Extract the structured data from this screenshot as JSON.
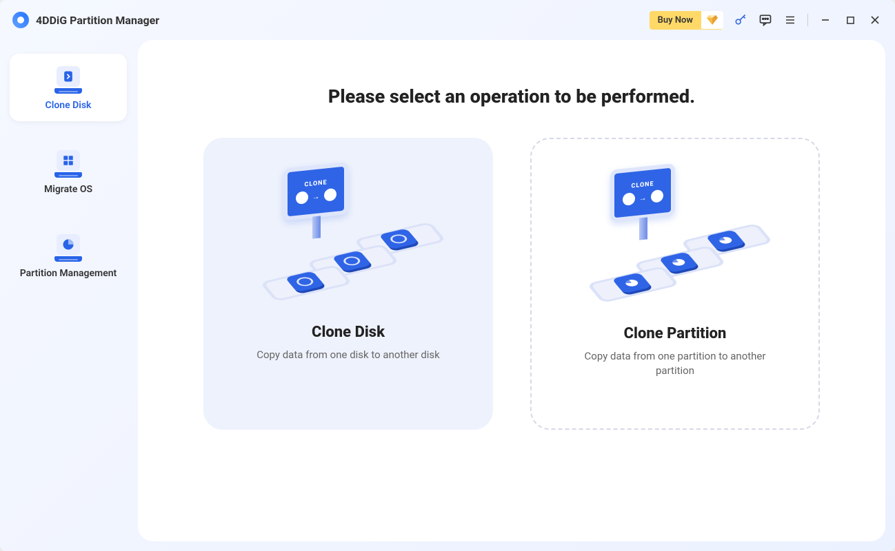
{
  "app": {
    "title": "4DDiG Partition Manager"
  },
  "titlebar": {
    "buy_now": "Buy Now"
  },
  "sidebar": {
    "items": [
      {
        "label": "Clone Disk",
        "active": true
      },
      {
        "label": "Migrate OS",
        "active": false
      },
      {
        "label": "Partition Management",
        "active": false
      }
    ]
  },
  "main": {
    "heading": "Please select an operation to be performed.",
    "cards": [
      {
        "title": "Clone Disk",
        "description": "Copy data from one disk to another disk",
        "monitor_label": "CLONE",
        "state": "selected"
      },
      {
        "title": "Clone Partition",
        "description": "Copy data from one partition to another partition",
        "monitor_label": "CLONE",
        "state": "dashed"
      }
    ]
  }
}
